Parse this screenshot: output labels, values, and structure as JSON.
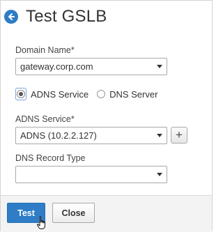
{
  "dialog": {
    "title": "Test GSLB",
    "back_icon": "arrow-left-icon"
  },
  "form": {
    "domain_name": {
      "label": "Domain Name*",
      "value": "gateway.corp.com"
    },
    "service_type": {
      "options": [
        {
          "label": "ADNS Service",
          "selected": true
        },
        {
          "label": "DNS Server",
          "selected": false
        }
      ]
    },
    "adns_service": {
      "label": "ADNS Service*",
      "value": "ADNS (10.2.2.127)",
      "add_label": "+"
    },
    "dns_record_type": {
      "label": "DNS Record Type",
      "value": ""
    }
  },
  "footer": {
    "test_label": "Test",
    "close_label": "Close"
  },
  "colors": {
    "accent": "#2e7dc6",
    "footer_bg": "#f3f3f3"
  }
}
